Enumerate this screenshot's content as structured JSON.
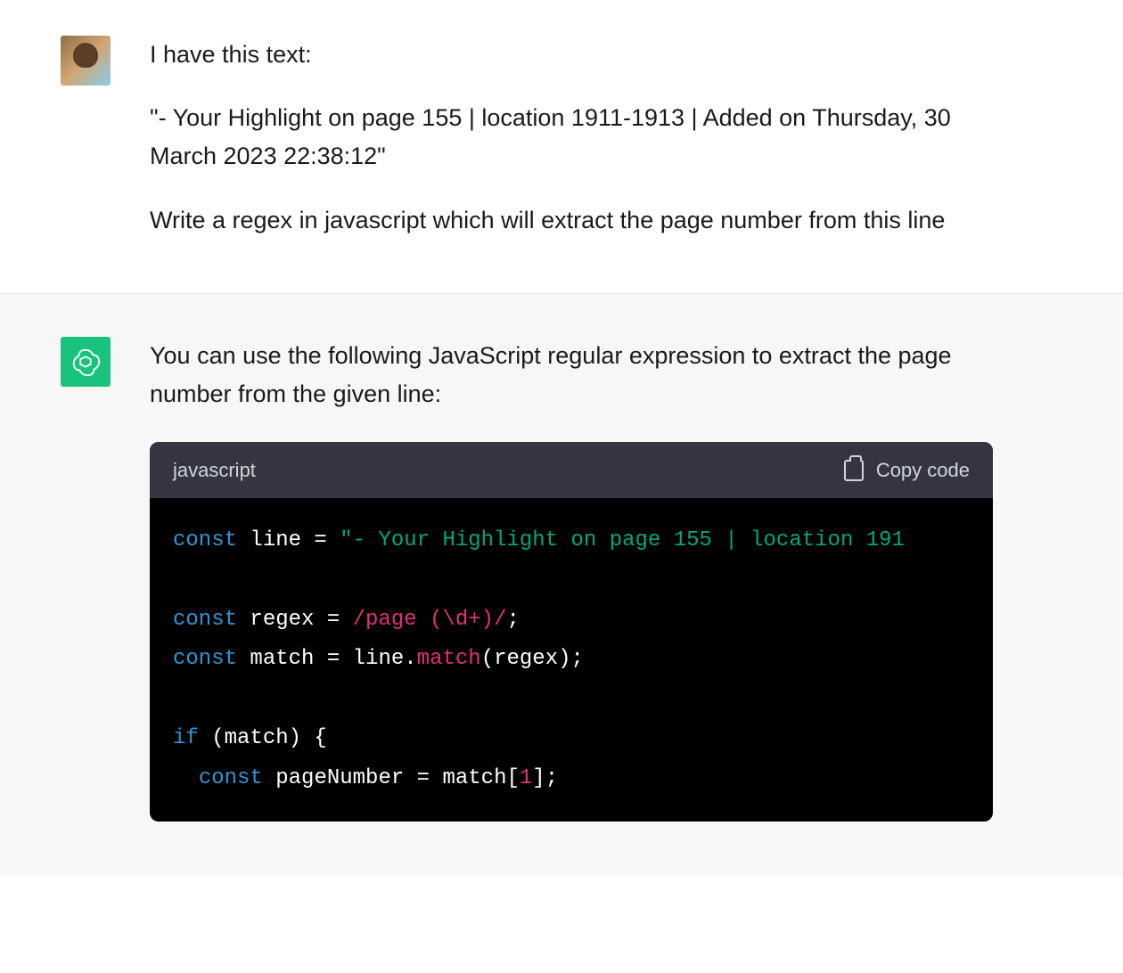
{
  "user_message": {
    "paragraphs": [
      "I have this text:",
      "\"- Your Highlight on page 155 | location 1911-1913 | Added on Thursday, 30 March 2023 22:38:12\"",
      "Write a regex in javascript which will extract the page number from this line"
    ]
  },
  "assistant_message": {
    "intro": "You can use the following JavaScript regular expression to extract the page number from the given line:",
    "code": {
      "language": "javascript",
      "copy_label": "Copy code",
      "tokens": {
        "kw_const": "const",
        "kw_if": "if",
        "var_line": "line",
        "var_regex": "regex",
        "var_match": "match",
        "var_pageNumber": "pageNumber",
        "eq": " = ",
        "str_line": "\"- Your Highlight on page 155 | location 191",
        "regex_literal": "/page (\\d+)/",
        "semi": ";",
        "dot": ".",
        "method_match": "match",
        "paren_regex_call": "(regex);",
        "if_open": " (match) {",
        "indent2": "  ",
        "match_access_open": " = match[",
        "num_one": "1",
        "match_access_close": "];"
      }
    }
  }
}
